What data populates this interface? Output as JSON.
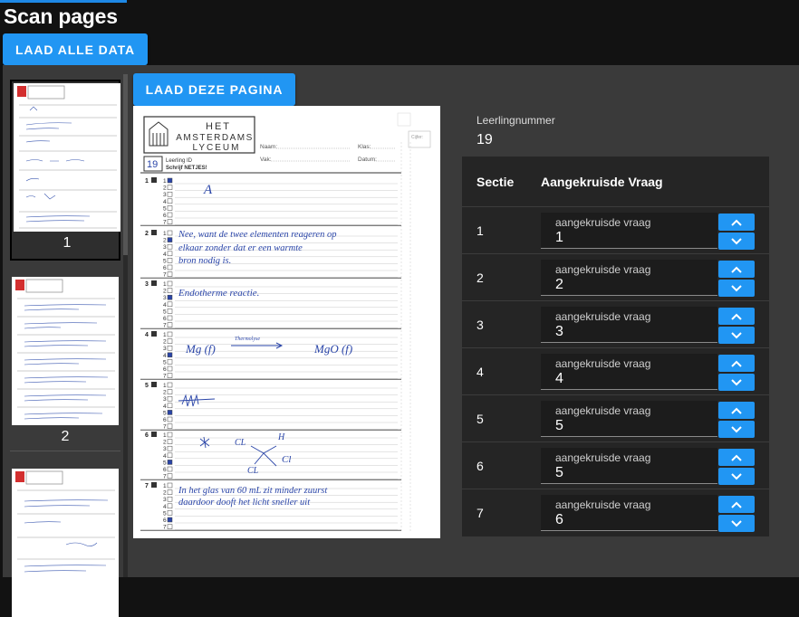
{
  "app": {
    "title": "Scan pages"
  },
  "toolbar": {
    "load_all_label": "LAAD ALLE DATA"
  },
  "thumbnails": [
    {
      "label": "1",
      "selected": true
    },
    {
      "label": "2",
      "selected": false
    }
  ],
  "viewer": {
    "load_page_label": "LAAD DEZE PAGINA"
  },
  "scan": {
    "logo_line1": "HET",
    "logo_line2": "AMSTERDAMS",
    "logo_line3": "LYCEUM",
    "name_label": "Naam:",
    "class_label": "Klas:",
    "subject_label": "Vak:",
    "date_label": "Datum:",
    "id_value": "19",
    "id_label": "Leerling ID",
    "id_note": "Schrijf NETJES!",
    "tick_label": "Cijfer:",
    "questions": [
      "1",
      "2",
      "3",
      "4",
      "5",
      "6",
      "7"
    ],
    "answers": [
      "A",
      "Nee, want de twee elementen reageren op elkaar zonder dat er een warmte bron nodig is.",
      "Endotherme reactie.",
      "Mg (f) → MgO (f)",
      "",
      "",
      "In het glas van 60 mL zit minder zuurstof daardoor dooft het licht sneller uit"
    ],
    "arrow_note": "Thermolyse"
  },
  "panel": {
    "student_number_label": "Leerlingnummer",
    "student_number": "19",
    "col_section": "Sectie",
    "col_question": "Aangekruisde Vraag",
    "field_label": "aangekruisde vraag",
    "rows": [
      {
        "section": "1",
        "value": "1"
      },
      {
        "section": "2",
        "value": "2"
      },
      {
        "section": "3",
        "value": "3"
      },
      {
        "section": "4",
        "value": "4"
      },
      {
        "section": "5",
        "value": "5"
      },
      {
        "section": "6",
        "value": "5"
      },
      {
        "section": "7",
        "value": "6"
      }
    ]
  },
  "colors": {
    "accent": "#2196f3",
    "background": "#121212",
    "panel": "#252525",
    "workspace": "#3a3a3a"
  },
  "icons": {
    "up": "chevron-up-icon",
    "down": "chevron-down-icon"
  }
}
